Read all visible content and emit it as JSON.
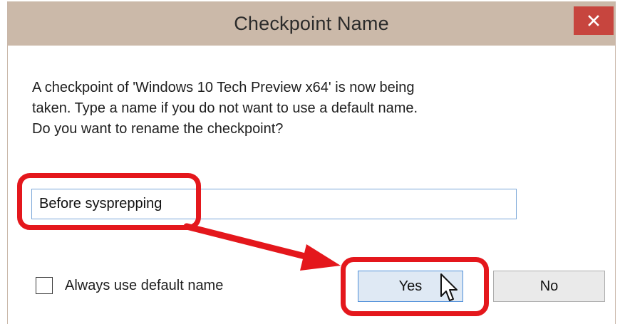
{
  "window": {
    "title": "Checkpoint Name",
    "close_glyph": "✕"
  },
  "message": {
    "line1": "A checkpoint of 'Windows 10 Tech Preview x64' is now being",
    "line2": "taken. Type a name if you do not want to use a default name.",
    "line3": "Do you want to rename the checkpoint?"
  },
  "name_input": {
    "value": "Before sysprepping"
  },
  "default_name_checkbox": {
    "label": "Always use default name",
    "checked": false
  },
  "buttons": {
    "yes_label": "Yes",
    "no_label": "No"
  },
  "annotation": {
    "highlight_color": "#e4171c",
    "arrow_color": "#e4171c"
  },
  "colors": {
    "titlebar": "#cbb9a9",
    "close_button": "#c7453e",
    "focus_border": "#4f8fd9"
  }
}
